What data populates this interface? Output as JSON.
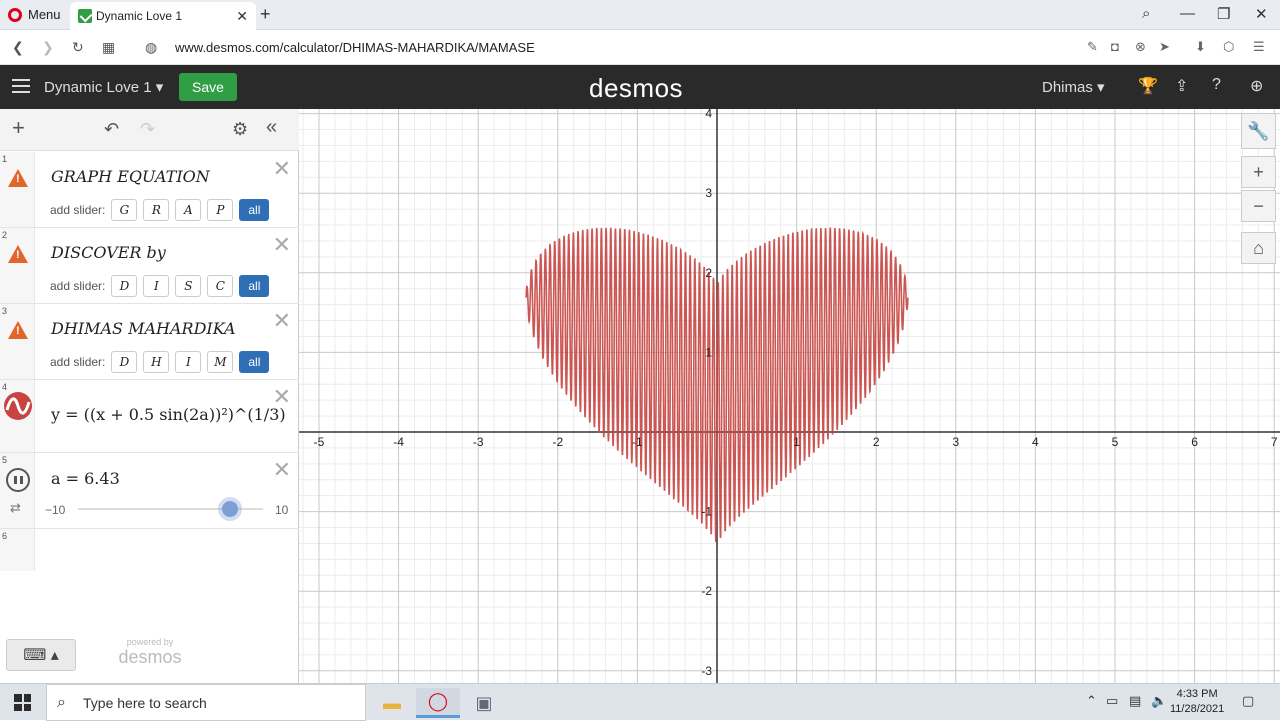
{
  "browser": {
    "menu_label": "Menu",
    "tab_title": "Dynamic Love 1",
    "url": "www.desmos.com/calculator/DHIMAS-MAHARDIKA/MAMASE"
  },
  "header": {
    "graph_title": "Dynamic Love 1",
    "save_label": "Save",
    "logo": "desmos",
    "user": "Dhimas"
  },
  "expressions": [
    {
      "num": "1",
      "text": "GRAPH EQUATION",
      "slider_label": "add slider:",
      "chips": [
        "G",
        "R",
        "A",
        "P"
      ],
      "all": "all"
    },
    {
      "num": "2",
      "text": "DISCOVER by",
      "slider_label": "add slider:",
      "chips": [
        "D",
        "I",
        "S",
        "C"
      ],
      "all": "all"
    },
    {
      "num": "3",
      "text": "DHIMAS MAHARDIKA",
      "slider_label": "add slider:",
      "chips": [
        "D",
        "H",
        "I",
        "M"
      ],
      "all": "all"
    },
    {
      "num": "4",
      "formula": "y = ((x + 0.5 sin(2a))²)^(1/3)"
    },
    {
      "num": "5",
      "formula": "a = 6.43",
      "slider_min": "−10",
      "slider_max": "10",
      "slider_value": 6.43
    },
    {
      "num": "6"
    }
  ],
  "branding": {
    "powered_by": "powered by",
    "logo": "desmos"
  },
  "graph": {
    "x_ticks": [
      "-5",
      "-4",
      "-3",
      "-2",
      "-1",
      "1",
      "2",
      "3",
      "4",
      "5",
      "6",
      "7"
    ],
    "y_ticks": [
      "4",
      "3",
      "2",
      "1",
      "-1",
      "-2",
      "-3"
    ],
    "curve_color": "#c74440"
  },
  "taskbar": {
    "search_placeholder": "Type here to search",
    "time": "4:33 PM",
    "date": "11/28/2021"
  }
}
